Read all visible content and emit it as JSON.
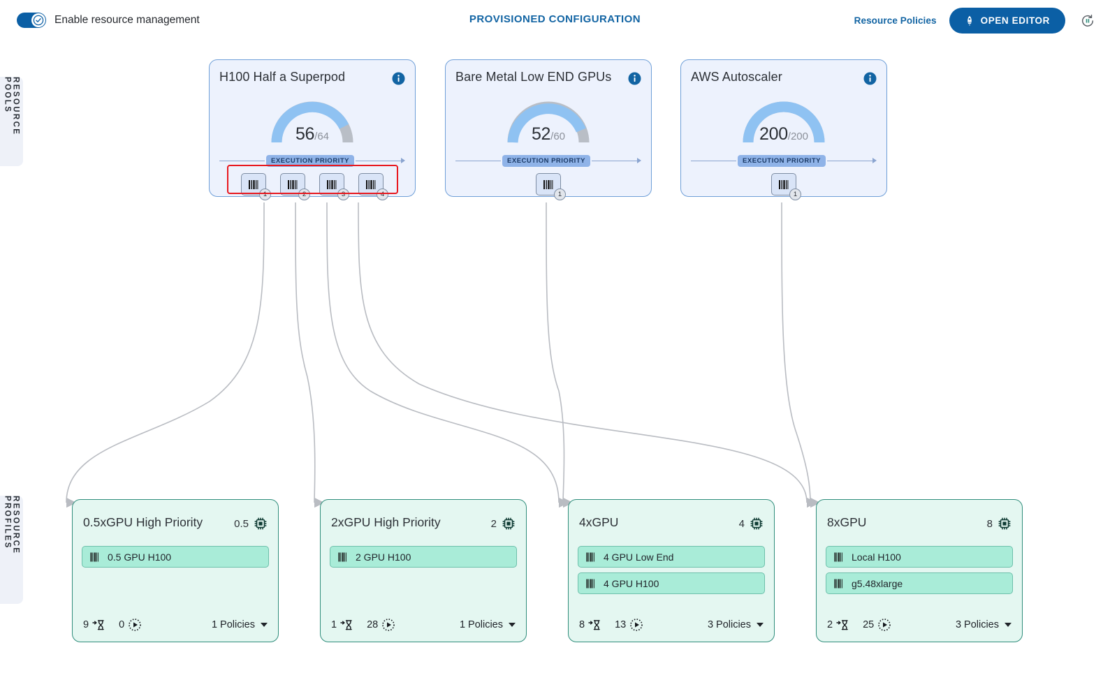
{
  "header": {
    "toggle_label": "Enable resource management",
    "toggle_on": true,
    "title": "PROVISIONED CONFIGURATION",
    "resource_policies_link": "Resource Policies",
    "open_editor_button": "OPEN EDITOR",
    "refresh_icon": "refresh-pause-icon",
    "accent_color": "#0b5fa5",
    "title_color": "#1264a3"
  },
  "rails": {
    "pools": "RESOURCE POOLS",
    "profiles": "RESOURCE PROFILES"
  },
  "execution_priority_label": "EXECUTION PRIORITY",
  "pools": [
    {
      "name": "H100 Half a Superpod",
      "used": 56,
      "capacity": 64,
      "capacity_label": "/64",
      "selected": true,
      "chips": [
        {
          "badge": "1",
          "icon": "barcode-icon"
        },
        {
          "badge": "2",
          "icon": "barcode-icon"
        },
        {
          "badge": "3",
          "icon": "barcode-icon"
        },
        {
          "badge": "4",
          "icon": "barcode-icon"
        }
      ]
    },
    {
      "name": "Bare Metal Low END GPUs",
      "used": 52,
      "capacity": 60,
      "capacity_label": "/60",
      "selected": false,
      "chips": [
        {
          "badge": "1",
          "icon": "barcode-icon"
        }
      ]
    },
    {
      "name": "AWS Autoscaler",
      "used": 200,
      "capacity": 200,
      "capacity_label": "/200",
      "selected": false,
      "chips": [
        {
          "badge": "1",
          "icon": "barcode-icon"
        }
      ]
    }
  ],
  "profiles": [
    {
      "name": "0.5xGPU High Priority",
      "gpu_count": "0.5",
      "items": [
        "0.5 GPU H100"
      ],
      "pending": "9",
      "running": "0",
      "policies": "1 Policies"
    },
    {
      "name": "2xGPU High Priority",
      "gpu_count": "2",
      "items": [
        "2 GPU H100"
      ],
      "pending": "1",
      "running": "28",
      "policies": "1 Policies"
    },
    {
      "name": "4xGPU",
      "gpu_count": "4",
      "items": [
        "4 GPU Low End",
        "4 GPU H100"
      ],
      "pending": "8",
      "running": "13",
      "policies": "3 Policies"
    },
    {
      "name": "8xGPU",
      "gpu_count": "8",
      "items": [
        "Local H100",
        "g5.48xlarge"
      ],
      "pending": "2",
      "running": "25",
      "policies": "3 Policies"
    }
  ],
  "colors": {
    "pool_fill": "#edf2fd",
    "pool_border": "#6f9fd8",
    "profile_fill": "#e4f7f1",
    "profile_border": "#2f8d7b",
    "profile_item_fill": "#a9ecd8",
    "gauge_arc": "#8fc2f2",
    "gauge_track": "#b9bec6",
    "selection": "#e8181f",
    "connector": "#b9bcc2"
  }
}
